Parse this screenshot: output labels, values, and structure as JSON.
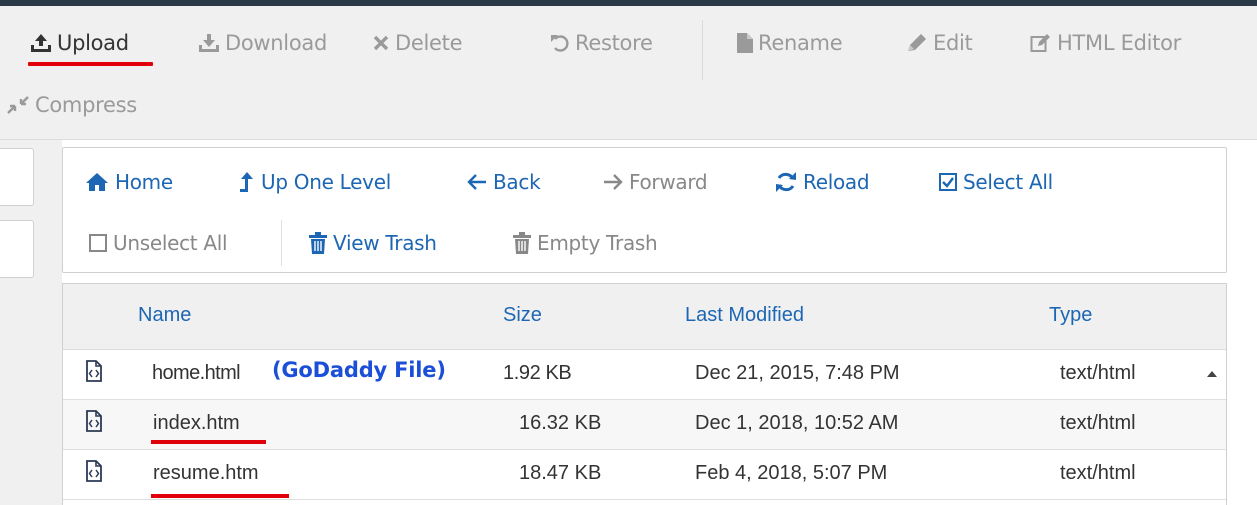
{
  "toolbar": {
    "upload": "Upload",
    "download": "Download",
    "delete": "Delete",
    "restore": "Restore",
    "rename": "Rename",
    "edit": "Edit",
    "html_editor": "HTML Editor",
    "compress": "Compress"
  },
  "nav": {
    "home": "Home",
    "up_one_level": "Up One Level",
    "back": "Back",
    "forward": "Forward",
    "reload": "Reload",
    "select_all": "Select All",
    "unselect_all": "Unselect All",
    "view_trash": "View Trash",
    "empty_trash": "Empty Trash"
  },
  "table": {
    "columns": [
      "Name",
      "Size",
      "Last Modified",
      "Type"
    ],
    "rows": [
      {
        "name": "home.html",
        "size": "1.92 KB",
        "modified": "Dec 21, 2015, 7:48 PM",
        "type": "text/html"
      },
      {
        "name": "index.htm",
        "size": "16.32 KB",
        "modified": "Dec 1, 2018, 10:52 AM",
        "type": "text/html"
      },
      {
        "name": "resume.htm",
        "size": "18.47 KB",
        "modified": "Feb 4, 2018, 5:07 PM",
        "type": "text/html"
      }
    ]
  },
  "annotation": "(GoDaddy File)",
  "colors": {
    "link_blue": "#1d66b3",
    "highlight_red": "#e0000a",
    "annotation_blue": "#1c4fd8",
    "toolbar_bg": "#f0f0f0"
  },
  "icons": {
    "upload": "upload-icon",
    "download": "download-icon",
    "delete": "x-icon",
    "restore": "undo-icon",
    "rename": "file-icon",
    "edit": "pencil-icon",
    "html_editor": "edit-box-icon",
    "compress": "compress-icon",
    "home": "home-icon",
    "up_one_level": "level-up-icon",
    "back": "arrow-left-icon",
    "forward": "arrow-right-icon",
    "reload": "refresh-icon",
    "select_all": "checked-box-icon",
    "unselect_all": "empty-box-icon",
    "view_trash": "trash-icon",
    "empty_trash": "trash-icon",
    "file": "code-file-icon"
  }
}
